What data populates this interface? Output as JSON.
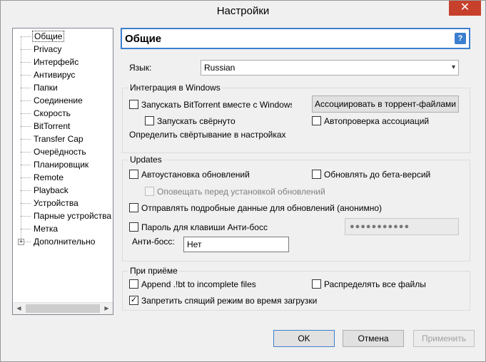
{
  "window": {
    "title": "Настройки",
    "close_glyph": "✕"
  },
  "sidebar": {
    "items": [
      {
        "label": "Общие"
      },
      {
        "label": "Privacy"
      },
      {
        "label": "Интерфейс"
      },
      {
        "label": "Антивирус"
      },
      {
        "label": "Папки"
      },
      {
        "label": "Соединение"
      },
      {
        "label": "Скорость"
      },
      {
        "label": "BitTorrent"
      },
      {
        "label": "Transfer Cap"
      },
      {
        "label": "Очерёдность"
      },
      {
        "label": "Планировщик"
      },
      {
        "label": "Remote"
      },
      {
        "label": "Playback"
      },
      {
        "label": "Устройства"
      },
      {
        "label": "Парные устройства"
      },
      {
        "label": "Метка"
      },
      {
        "label": "Дополнительно"
      }
    ],
    "selected": "Общие",
    "expander_glyph": "+"
  },
  "panel": {
    "title": "Общие",
    "help_glyph": "?",
    "language_label": "Язык:",
    "language_value": "Russian",
    "windows_group": {
      "title": "Интеграция в Windows",
      "start_with_windows": "Запускать BitTorrent вместе с Windows",
      "start_minimized": "Запускать свёрнуто",
      "minimize_note": "Определить свёртывание в настройках",
      "associate_button": "Ассоциировать в торрент-файлами",
      "check_associations": "Автопроверка ассоциаций"
    },
    "updates_group": {
      "title": "Updates",
      "auto_install": "Автоустановка обновлений",
      "update_beta": "Обновлять до бета-версий",
      "notify_before": "Оповещать перед установкой обновлений",
      "send_details": "Отправлять подробные данные для обновлений (анонимно)",
      "boss_password": "Пароль для клавиши Анти-босс",
      "boss_password_value": "●●●●●●●●●●●",
      "boss_key_label": "Анти-босс:",
      "boss_key_value": "Нет"
    },
    "download_group": {
      "title": "При приёме",
      "append_bt": "Append .!bt to incomplete files",
      "distribute_all": "Распределять все файлы",
      "prevent_sleep": "Запретить спящий режим во время загрузки"
    }
  },
  "buttons": {
    "ok": "OK",
    "cancel": "Отмена",
    "apply": "Применить"
  },
  "icons": {
    "checkmark": "✓",
    "chevron": "▾",
    "scroll_left": "◀",
    "scroll_right": "▶"
  },
  "colors": {
    "accent": "#3c7fcf",
    "close": "#c7402c"
  }
}
